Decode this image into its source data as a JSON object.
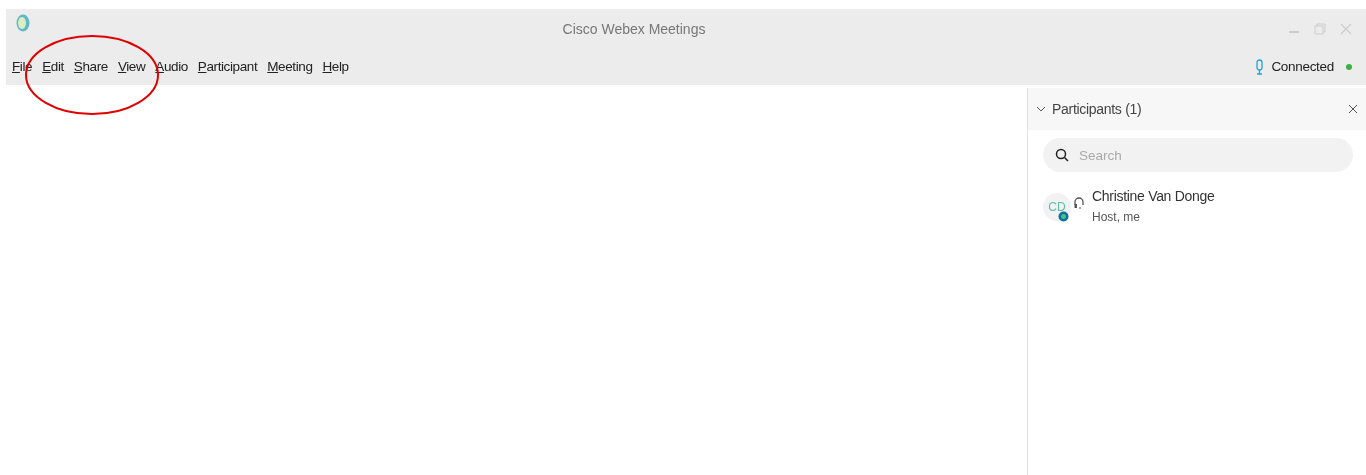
{
  "window": {
    "title": "Cisco Webex Meetings"
  },
  "menu": [
    "File",
    "Edit",
    "Share",
    "View",
    "Audio",
    "Participant",
    "Meeting",
    "Help"
  ],
  "status": {
    "label": "Connected",
    "connected": true
  },
  "participants_panel": {
    "title": "Participants (1)",
    "expanded": true,
    "search": {
      "placeholder": "Search"
    },
    "participants": [
      {
        "initials": "CD",
        "name": "Christine Van Donge",
        "role": "Host, me"
      }
    ]
  }
}
